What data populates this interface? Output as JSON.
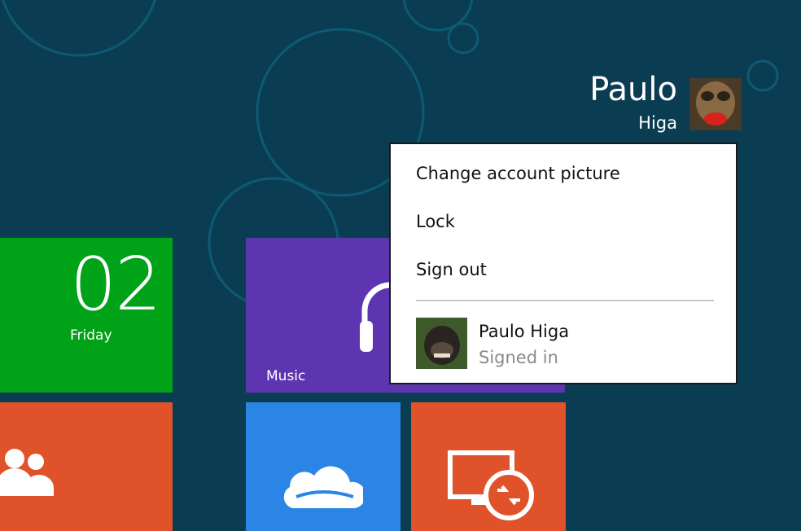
{
  "user": {
    "first_name": "Paulo",
    "last_name": "Higa"
  },
  "account_menu": {
    "items": [
      {
        "label": "Change account picture"
      },
      {
        "label": "Lock"
      },
      {
        "label": "Sign out"
      }
    ],
    "account": {
      "name": "Paulo Higa",
      "status": "Signed in"
    }
  },
  "tiles": {
    "calendar": {
      "date": "02",
      "day": "Friday",
      "color": "#00a218"
    },
    "music": {
      "label": "Music",
      "color": "#5e35b1"
    },
    "people": {
      "color": "#e0522a"
    },
    "skydrive": {
      "color": "#2b85e4"
    },
    "remote_desktop": {
      "color": "#e0522a"
    }
  },
  "colors": {
    "background": "#0b3d52",
    "menu_background": "#ffffff",
    "menu_text": "#111111",
    "menu_subtext": "#8a8a8a"
  },
  "icons": {
    "music": "headphones-icon",
    "people": "people-icon",
    "skydrive": "cloud-icon",
    "remote_desktop": "remote-desktop-icon"
  }
}
